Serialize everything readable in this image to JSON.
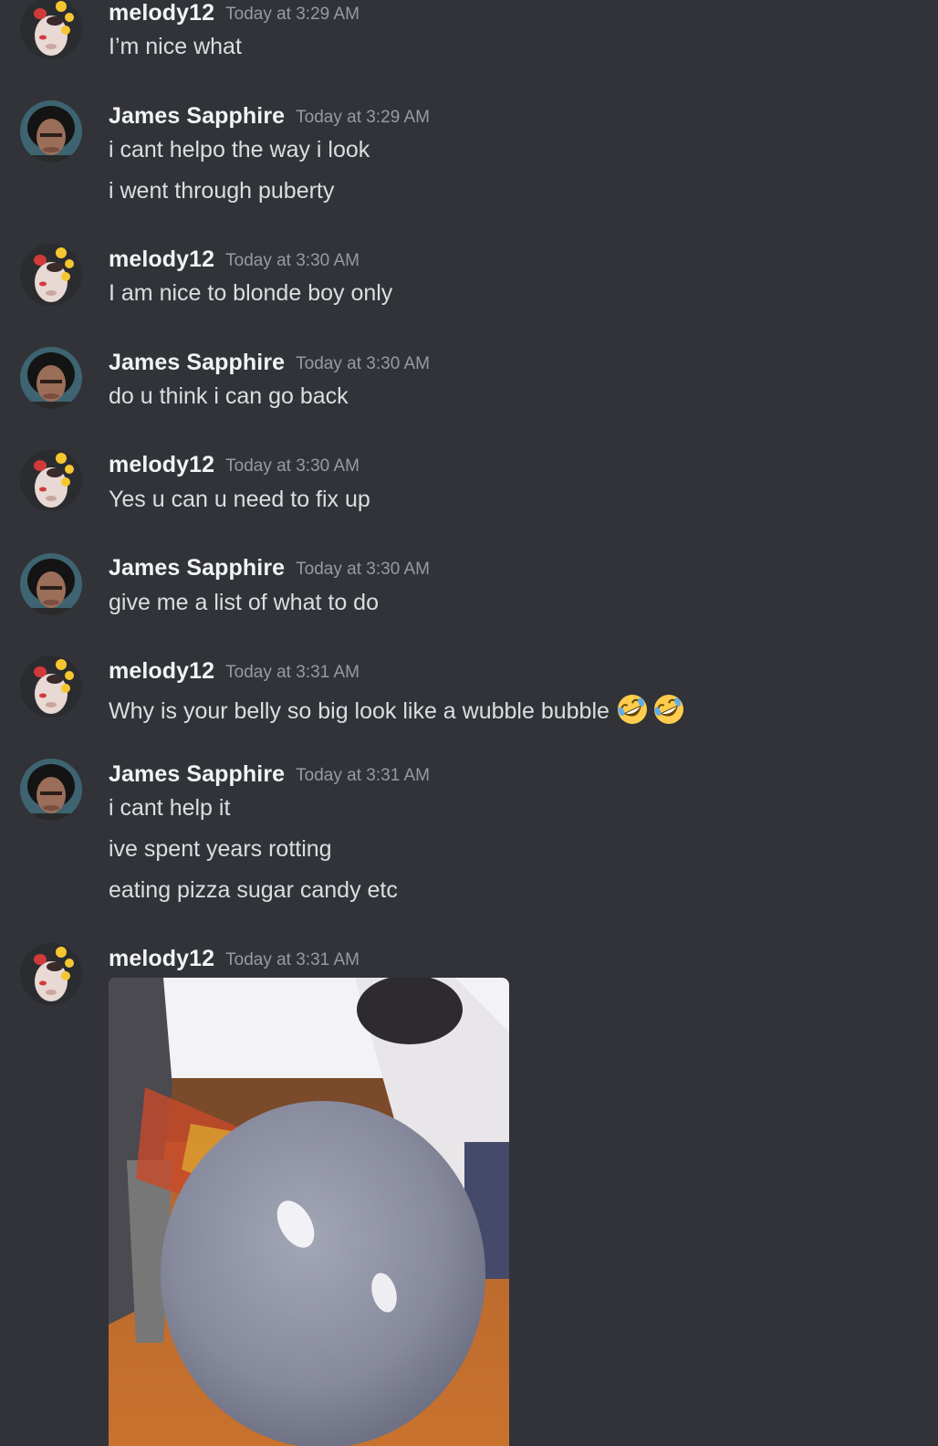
{
  "messages": [
    {
      "username": "melody12",
      "timestamp": "Today at 3:29 AM",
      "avatar": "melody-avatar",
      "lines": [
        "I’m nice what"
      ]
    },
    {
      "username": "James Sapphire",
      "timestamp": "Today at 3:29 AM",
      "avatar": "james-avatar",
      "lines": [
        "i cant helpo the way i look",
        "i went through puberty"
      ]
    },
    {
      "username": "melody12",
      "timestamp": "Today at 3:30 AM",
      "avatar": "melody-avatar",
      "lines": [
        "I am nice to blonde boy only"
      ]
    },
    {
      "username": "James Sapphire",
      "timestamp": "Today at 3:30 AM",
      "avatar": "james-avatar",
      "lines": [
        "do u think i can go back"
      ]
    },
    {
      "username": "melody12",
      "timestamp": "Today at 3:30 AM",
      "avatar": "melody-avatar",
      "lines": [
        "Yes u can u need to fix up"
      ]
    },
    {
      "username": "James Sapphire",
      "timestamp": "Today at 3:30 AM",
      "avatar": "james-avatar",
      "lines": [
        "give me a list of what to do"
      ]
    },
    {
      "username": "melody12",
      "timestamp": "Today at 3:31 AM",
      "avatar": "melody-avatar",
      "lines": [
        "Why is your belly so big look like a wubble bubble"
      ],
      "emojis": [
        "rolling-on-floor-laughing-emoji",
        "rolling-on-floor-laughing-emoji"
      ]
    },
    {
      "username": "James Sapphire",
      "timestamp": "Today at 3:31 AM",
      "avatar": "james-avatar",
      "lines": [
        "i cant help it",
        "ive spent years rotting",
        "eating pizza sugar candy etc"
      ]
    },
    {
      "username": "melody12",
      "timestamp": "Today at 3:31 AM",
      "avatar": "melody-avatar",
      "lines": [],
      "attachment": "gif-image"
    }
  ],
  "colors": {
    "background": "#313338",
    "username": "#f2f3f5",
    "timestamp": "#949ba4",
    "message_text": "#dbdee1"
  }
}
